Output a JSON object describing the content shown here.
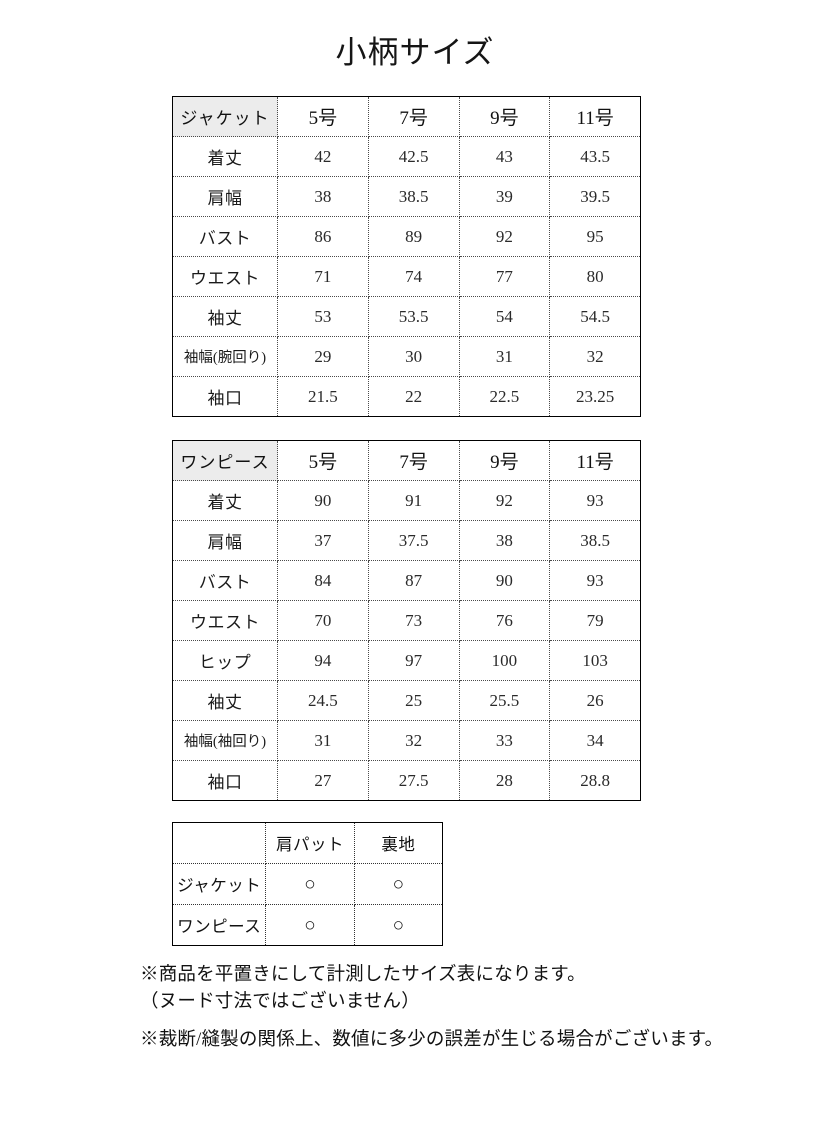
{
  "title": "小柄サイズ",
  "tables": {
    "jacket": {
      "corner_label": "ジャケット",
      "size_headers": [
        "5号",
        "7号",
        "9号",
        "11号"
      ],
      "rows": [
        {
          "label": "着丈",
          "values": [
            "42",
            "42.5",
            "43",
            "43.5"
          ]
        },
        {
          "label": "肩幅",
          "values": [
            "38",
            "38.5",
            "39",
            "39.5"
          ]
        },
        {
          "label": "バスト",
          "values": [
            "86",
            "89",
            "92",
            "95"
          ]
        },
        {
          "label": "ウエスト",
          "values": [
            "71",
            "74",
            "77",
            "80"
          ]
        },
        {
          "label": "袖丈",
          "values": [
            "53",
            "53.5",
            "54",
            "54.5"
          ]
        },
        {
          "label": "袖幅(腕回り)",
          "values": [
            "29",
            "30",
            "31",
            "32"
          ]
        },
        {
          "label": "袖口",
          "values": [
            "21.5",
            "22",
            "22.5",
            "23.25"
          ]
        }
      ]
    },
    "dress": {
      "corner_label": "ワンピース",
      "size_headers": [
        "5号",
        "7号",
        "9号",
        "11号"
      ],
      "rows": [
        {
          "label": "着丈",
          "values": [
            "90",
            "91",
            "92",
            "93"
          ]
        },
        {
          "label": "肩幅",
          "values": [
            "37",
            "37.5",
            "38",
            "38.5"
          ]
        },
        {
          "label": "バスト",
          "values": [
            "84",
            "87",
            "90",
            "93"
          ]
        },
        {
          "label": "ウエスト",
          "values": [
            "70",
            "73",
            "76",
            "79"
          ]
        },
        {
          "label": "ヒップ",
          "values": [
            "94",
            "97",
            "100",
            "103"
          ]
        },
        {
          "label": "袖丈",
          "values": [
            "24.5",
            "25",
            "25.5",
            "26"
          ]
        },
        {
          "label": "袖幅(袖回り)",
          "values": [
            "31",
            "32",
            "33",
            "34"
          ]
        },
        {
          "label": "袖口",
          "values": [
            "27",
            "27.5",
            "28",
            "28.8"
          ]
        }
      ]
    },
    "features": {
      "corner_label": "",
      "headers": [
        "肩パット",
        "裏地"
      ],
      "rows": [
        {
          "label": "ジャケット",
          "values": [
            "○",
            "○"
          ]
        },
        {
          "label": "ワンピース",
          "values": [
            "○",
            "○"
          ]
        }
      ]
    }
  },
  "notes": [
    "※商品を平置きにして計測したサイズ表になります。",
    "（ヌード寸法ではございません）",
    "※裁断/縫製の関係上、数値に多少の誤差が生じる場合がございます。"
  ],
  "colors": {
    "page_background": "#ffffff",
    "text": "#111111",
    "table_border": "#000000",
    "grid_line": "#4a4a4a",
    "header_cell_background": "#ececec"
  }
}
